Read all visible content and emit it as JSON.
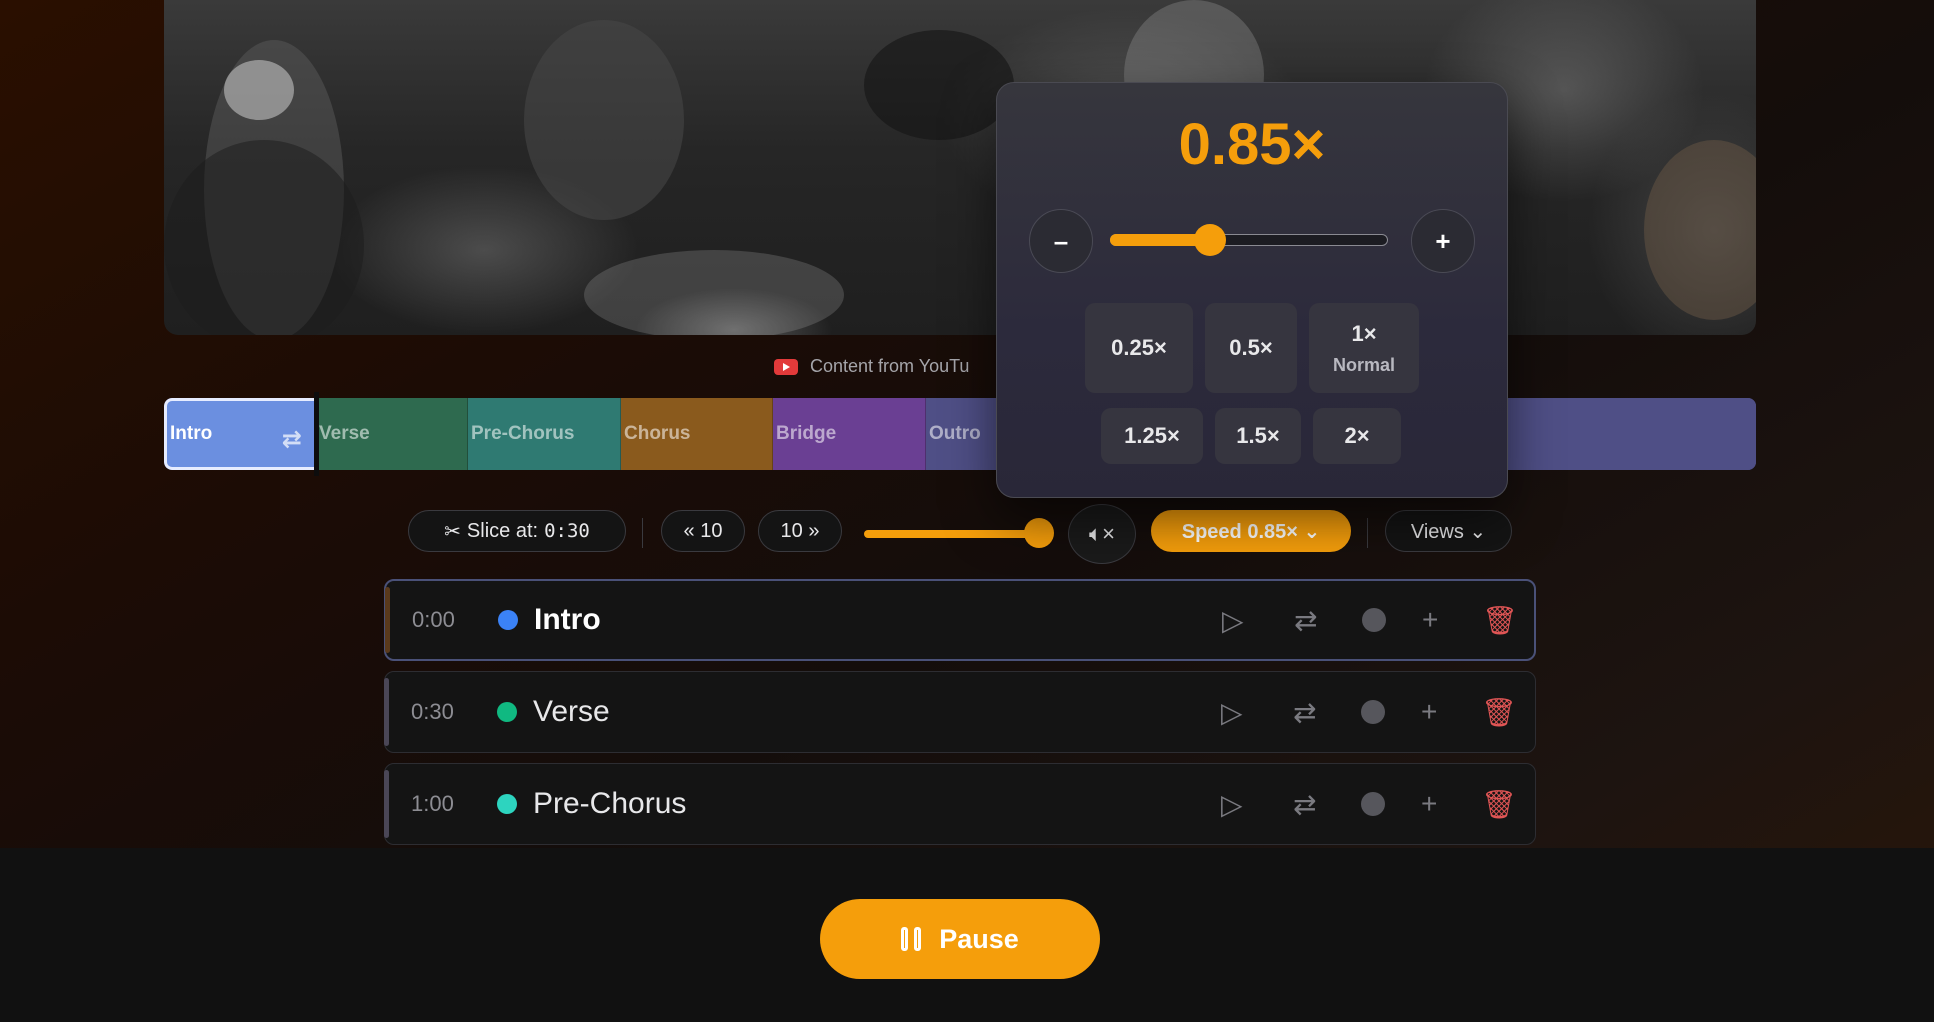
{
  "video": {
    "source_note": "Content from YouTu"
  },
  "timeline": {
    "sections": [
      {
        "label": "Intro",
        "color": "#6b8fe0"
      },
      {
        "label": "Verse",
        "color": "#2e6a4f"
      },
      {
        "label": "Pre-Chorus",
        "color": "#2f7a72"
      },
      {
        "label": "Chorus",
        "color": "#8a5a1d"
      },
      {
        "label": "Bridge",
        "color": "#6a3f93"
      },
      {
        "label": "Outro",
        "color": "#4f4f86"
      }
    ]
  },
  "controls": {
    "slice_label": "Slice at:",
    "slice_time": "0:30",
    "back_label": "« 10",
    "forward_label": "10 »",
    "volume_level": 1.0,
    "mute_icon": "speaker-muted-icon",
    "speed_label": "Speed 0.85× ⌄",
    "views_label": "Views ⌄"
  },
  "speed_popover": {
    "value": "0.85×",
    "slider_value": 0.85,
    "slider_min": 0.25,
    "slider_max": 2,
    "minus_label": "–",
    "plus_label": "+",
    "presets_row1": [
      {
        "label": "0.25×"
      },
      {
        "label": "0.5×"
      },
      {
        "label": "1×",
        "sub": "Normal"
      }
    ],
    "presets_row2": [
      {
        "label": "1.25×"
      },
      {
        "label": "1.5×"
      },
      {
        "label": "2×"
      }
    ]
  },
  "sections_list": [
    {
      "time": "0:00",
      "title": "Intro",
      "dot": "#3b82f6",
      "edge": "#5a3a1c"
    },
    {
      "time": "0:30",
      "title": "Verse",
      "dot": "#10b981",
      "edge": "#4a4656"
    },
    {
      "time": "1:00",
      "title": "Pre-Chorus",
      "dot": "#2dd4bf",
      "edge": "#4a4656"
    }
  ],
  "row_icons": [
    "play-icon",
    "loop-icon",
    "record-icon",
    "add-icon",
    "trash-icon"
  ],
  "playback": {
    "pause_label": "Pause"
  },
  "colors": {
    "accent": "#f59e0b",
    "danger": "#e05555"
  }
}
